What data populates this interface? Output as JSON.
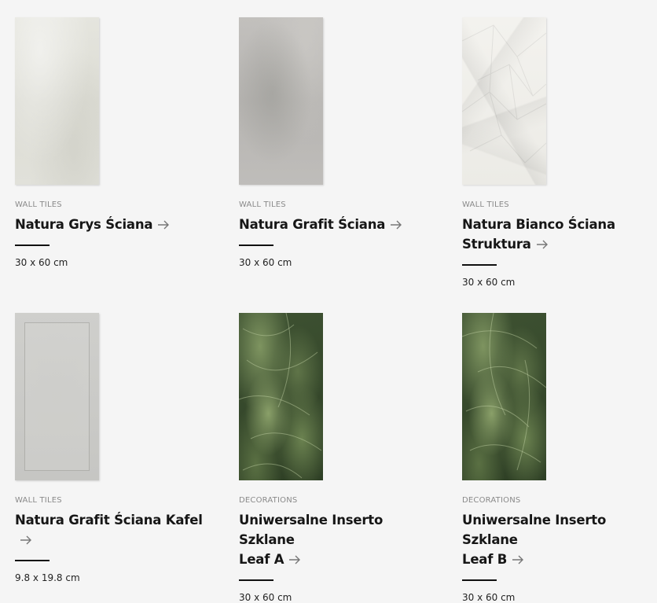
{
  "products": [
    {
      "category": "WALL TILES",
      "title": "Natura Grys Ściana",
      "size": "30 x 60 cm",
      "image": "natura-grys-tile"
    },
    {
      "category": "WALL TILES",
      "title": "Natura Grafit Ściana",
      "size": "30 x 60 cm",
      "image": "natura-grafit-tile"
    },
    {
      "category": "WALL TILES",
      "title_line1": "Natura Bianco Ściana",
      "title_line2": "Struktura",
      "size": "30 x 60 cm",
      "image": "natura-bianco-struktura-tile"
    },
    {
      "category": "WALL TILES",
      "title": "Natura Grafit Ściana Kafel",
      "size": "9.8 x 19.8 cm",
      "image": "natura-grafit-kafel-tile"
    },
    {
      "category": "DECORATIONS",
      "title_line1": "Uniwersalne Inserto Szklane",
      "title_line2": "Leaf A",
      "size": "30 x 60 cm",
      "image": "leaf-a-decor"
    },
    {
      "category": "DECORATIONS",
      "title_line1": "Uniwersalne Inserto Szklane",
      "title_line2": "Leaf B",
      "size": "30 x 60 cm",
      "image": "leaf-b-decor"
    }
  ],
  "arrow_icon": "arrow-right-icon",
  "colors": {
    "background": "#f5f5f5",
    "text": "#161616",
    "muted": "#8a8a8a",
    "rule": "#111111"
  }
}
